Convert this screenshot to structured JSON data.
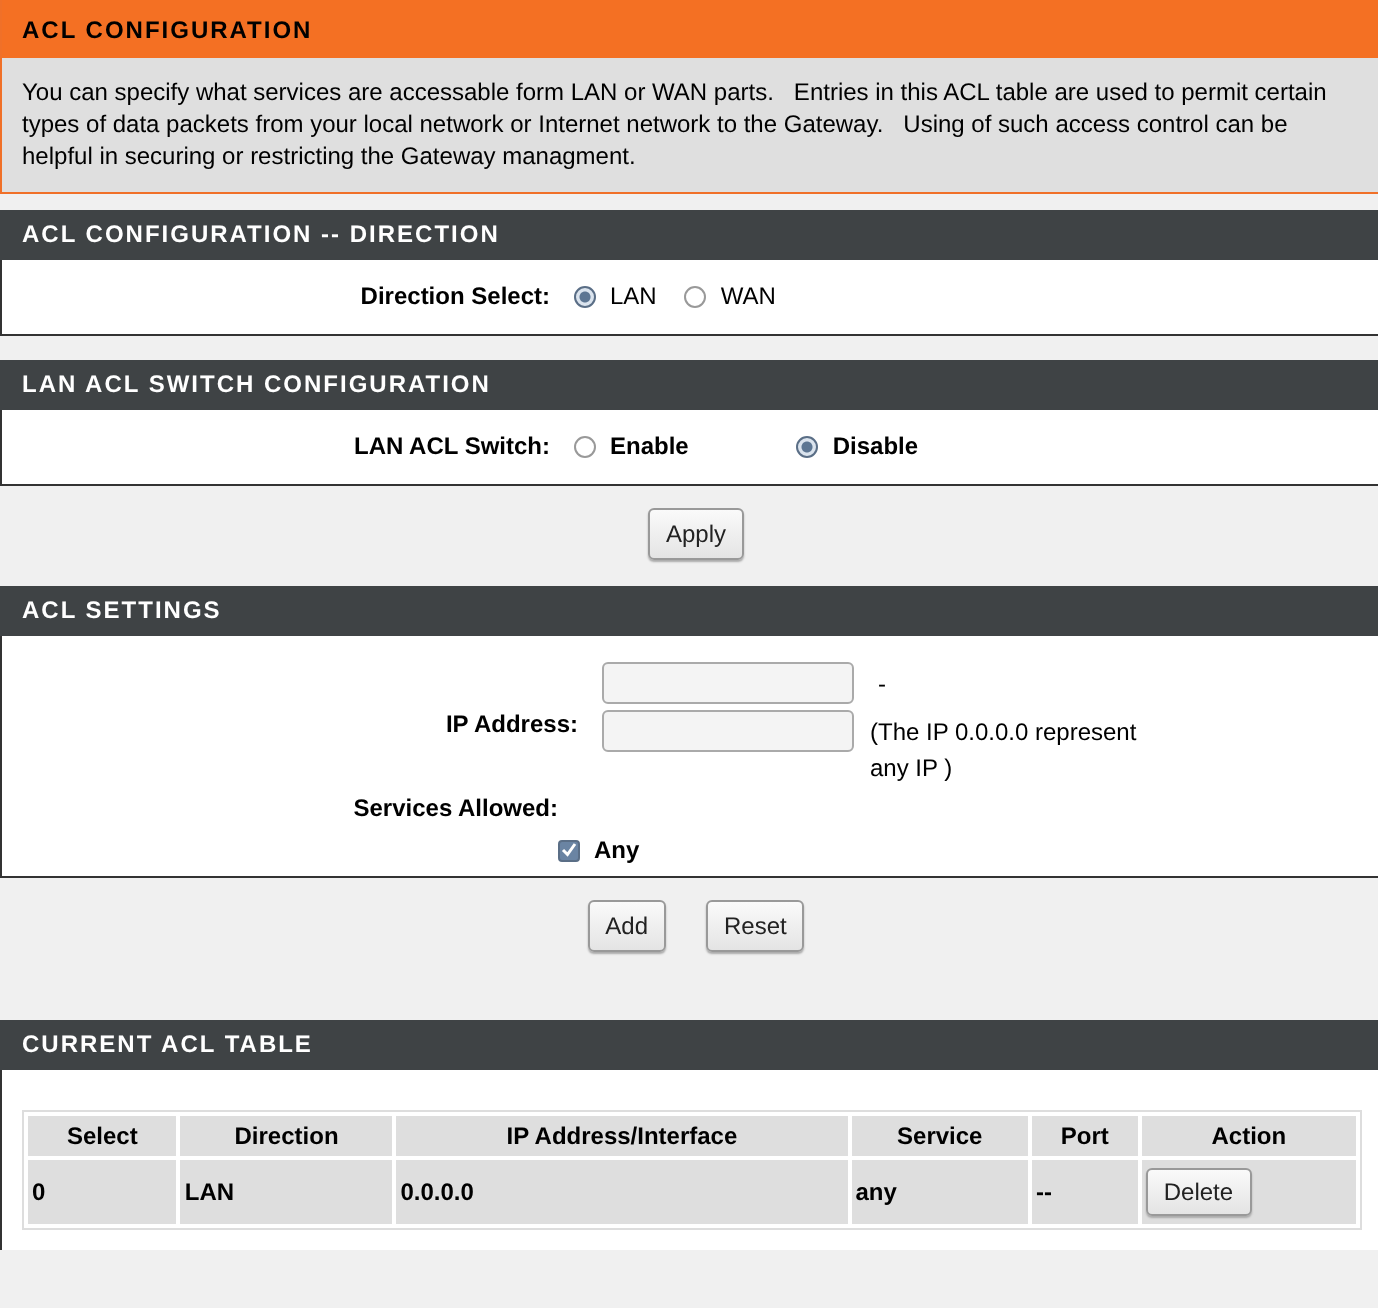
{
  "title": "ACL CONFIGURATION",
  "description": "You can specify what services are accessable form LAN or WAN parts.   Entries in this ACL table are used to permit certain types of data packets from your local network or Internet network to the Gateway.   Using of such access control can be helpful in securing or restricting the Gateway managment.",
  "direction": {
    "heading": "ACL CONFIGURATION -- DIRECTION",
    "label": "Direction Select:",
    "options": [
      {
        "label": "LAN",
        "selected": true
      },
      {
        "label": "WAN",
        "selected": false
      }
    ]
  },
  "switch": {
    "heading": "LAN ACL SWITCH CONFIGURATION",
    "label": "LAN ACL Switch:",
    "options": [
      {
        "label": "Enable",
        "selected": false
      },
      {
        "label": "Disable",
        "selected": true
      }
    ]
  },
  "apply_button": "Apply",
  "settings": {
    "heading": "ACL SETTINGS",
    "ip_label": "IP Address:",
    "separator": "-",
    "ip_hint": "(The IP 0.0.0.0 represent any IP )",
    "services_label": "Services Allowed:",
    "any": {
      "label": "Any",
      "checked": true
    }
  },
  "form_buttons": [
    "Add",
    "Reset"
  ],
  "table": {
    "heading": "CURRENT ACL TABLE",
    "columns": [
      "Select",
      "Direction",
      "IP Address/Interface",
      "Service",
      "Port",
      "Action"
    ],
    "rows": [
      {
        "cells": [
          "0",
          "LAN",
          "0.0.0.0",
          "any",
          "--"
        ],
        "action": "Delete"
      }
    ]
  }
}
